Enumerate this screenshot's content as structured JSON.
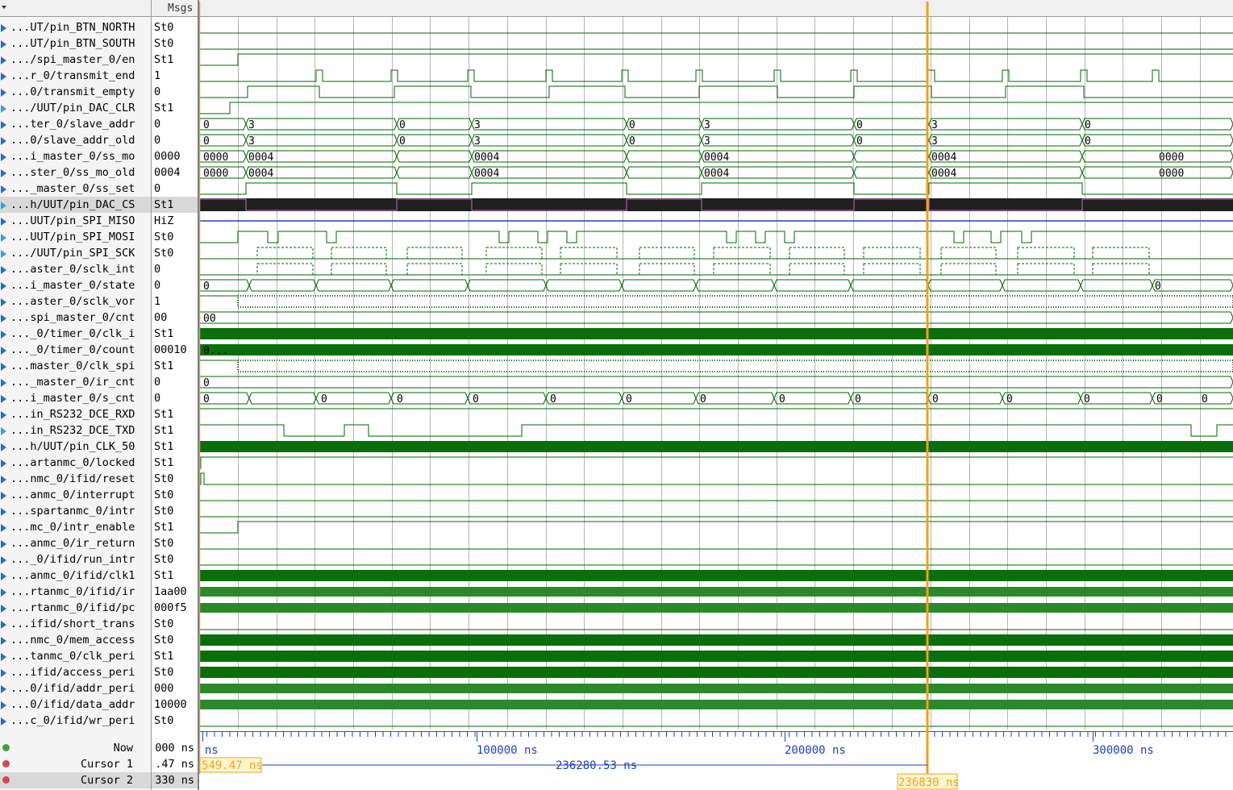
{
  "header": {
    "values_label": "Msgs"
  },
  "signals": [
    {
      "name": "...UT/pin_BTN_NORTH",
      "value": "St0",
      "kind": "bit",
      "icon": "in-icon"
    },
    {
      "name": "...UT/pin_BTN_SOUTH",
      "value": "St0",
      "kind": "bit",
      "icon": "in-icon"
    },
    {
      "name": ".../spi_master_0/en",
      "value": "St1",
      "kind": "bit",
      "icon": "in-icon"
    },
    {
      "name": "...r_0/transmit_end",
      "value": "1",
      "kind": "bit",
      "icon": "in-icon"
    },
    {
      "name": "...0/transmit_empty",
      "value": "0",
      "kind": "bit",
      "icon": "in-icon"
    },
    {
      "name": ".../UUT/pin_DAC_CLR",
      "value": "St1",
      "kind": "bit",
      "icon": "out-icon"
    },
    {
      "name": "...ter_0/slave_addr",
      "value": "0",
      "kind": "bus",
      "icon": "in-icon"
    },
    {
      "name": "...0/slave_addr_old",
      "value": "0",
      "kind": "bus",
      "icon": "in-icon"
    },
    {
      "name": "...i_master_0/ss_mo",
      "value": "0000",
      "kind": "bus",
      "icon": "in-icon"
    },
    {
      "name": "...ster_0/ss_mo_old",
      "value": "0004",
      "kind": "bus",
      "icon": "in-icon"
    },
    {
      "name": "..._master_0/ss_set",
      "value": "0",
      "kind": "bit",
      "icon": "in-icon"
    },
    {
      "name": "...h/UUT/pin_DAC_CS",
      "value": "St1",
      "kind": "selected",
      "icon": "out-icon"
    },
    {
      "name": "...UUT/pin_SPI_MISO",
      "value": "HiZ",
      "kind": "hiz",
      "icon": "in-icon"
    },
    {
      "name": "...UUT/pin_SPI_MOSI",
      "value": "St0",
      "kind": "bit",
      "icon": "out-icon"
    },
    {
      "name": ".../UUT/pin_SPI_SCK",
      "value": "St0",
      "kind": "clkburst",
      "icon": "out-icon"
    },
    {
      "name": "...aster_0/sclk_int",
      "value": "0",
      "kind": "clkburst",
      "icon": "in-icon"
    },
    {
      "name": "...i_master_0/state",
      "value": "0",
      "kind": "busdense",
      "icon": "in-icon"
    },
    {
      "name": "...aster_0/sclk_vor",
      "value": "1",
      "kind": "clkfast",
      "icon": "in-icon"
    },
    {
      "name": "...spi_master_0/cnt",
      "value": "00",
      "kind": "bus",
      "icon": "in-icon"
    },
    {
      "name": "..._0/timer_0/clk_i",
      "value": "St1",
      "kind": "solid",
      "icon": "in-icon"
    },
    {
      "name": "..._0/timer_0/count",
      "value": "00010",
      "kind": "solid",
      "icon": "in-icon"
    },
    {
      "name": "...master_0/clk_spi",
      "value": "St1",
      "kind": "clkfast",
      "icon": "in-icon"
    },
    {
      "name": "..._master_0/ir_cnt",
      "value": "0",
      "kind": "bus",
      "icon": "in-icon"
    },
    {
      "name": "...i_master_0/s_cnt",
      "value": "0",
      "kind": "busdense",
      "icon": "in-icon"
    },
    {
      "name": "...in_RS232_DCE_RXD",
      "value": "St1",
      "kind": "bit",
      "icon": "in-icon"
    },
    {
      "name": "...in_RS232_DCE_TXD",
      "value": "St1",
      "kind": "bit",
      "icon": "out-icon"
    },
    {
      "name": "...h/UUT/pin_CLK_50",
      "value": "St1",
      "kind": "solid",
      "icon": "in-icon"
    },
    {
      "name": "...artanmc_0/locked",
      "value": "St1",
      "kind": "bit",
      "icon": "in-icon"
    },
    {
      "name": "...nmc_0/ifid/reset",
      "value": "St0",
      "kind": "bit",
      "icon": "in-icon"
    },
    {
      "name": "...anmc_0/interrupt",
      "value": "St0",
      "kind": "bit",
      "icon": "in-icon"
    },
    {
      "name": "...spartanmc_0/intr",
      "value": "St0",
      "kind": "bit",
      "icon": "in-icon"
    },
    {
      "name": "...mc_0/intr_enable",
      "value": "St1",
      "kind": "bit",
      "icon": "in-icon"
    },
    {
      "name": "...anmc_0/ir_return",
      "value": "St0",
      "kind": "bit",
      "icon": "in-icon"
    },
    {
      "name": "..._0/ifid/run_intr",
      "value": "St0",
      "kind": "bit",
      "icon": "in-icon"
    },
    {
      "name": "...anmc_0/ifid/clk1",
      "value": "St1",
      "kind": "solid",
      "icon": "in-icon"
    },
    {
      "name": "...rtanmc_0/ifid/ir",
      "value": "1aa00",
      "kind": "busband",
      "icon": "in-icon"
    },
    {
      "name": "...rtanmc_0/ifid/pc",
      "value": "000f5",
      "kind": "busband",
      "icon": "in-icon"
    },
    {
      "name": "...ifid/short_trans",
      "value": "St0",
      "kind": "bit",
      "icon": "in-icon"
    },
    {
      "name": "...nmc_0/mem_access",
      "value": "St0",
      "kind": "solid",
      "icon": "in-icon"
    },
    {
      "name": "...tanmc_0/clk_peri",
      "value": "St1",
      "kind": "solid",
      "icon": "in-icon"
    },
    {
      "name": "...ifid/access_peri",
      "value": "St0",
      "kind": "solid",
      "icon": "in-icon"
    },
    {
      "name": "...0/ifid/addr_peri",
      "value": "000",
      "kind": "busband",
      "icon": "in-icon"
    },
    {
      "name": "...0/ifid/data_addr",
      "value": "10000",
      "kind": "busband",
      "icon": "in-icon"
    },
    {
      "name": "...c_0/ifid/wr_peri",
      "value": "St0",
      "kind": "bit",
      "icon": "in-icon"
    }
  ],
  "bus_labels": [
    {
      "row": 6,
      "items": [
        "0",
        "3",
        "0",
        "3",
        "0",
        "3",
        "0",
        "3",
        "0"
      ]
    },
    {
      "row": 7,
      "items": [
        "0",
        "3",
        "0",
        "3",
        "0",
        "3",
        "0",
        "3",
        "0"
      ]
    },
    {
      "row": 8,
      "items": [
        "0000",
        "0004",
        "0004",
        "0004",
        "0004",
        "0000"
      ]
    },
    {
      "row": 9,
      "items": [
        "0000",
        "0004",
        "0004",
        "0004",
        "0004",
        "0000"
      ]
    },
    {
      "row": 16,
      "items": [
        "0",
        "0"
      ]
    },
    {
      "row": 18,
      "items": [
        "00"
      ]
    },
    {
      "row": 20,
      "items": [
        "0..."
      ]
    },
    {
      "row": 22,
      "items": [
        "0"
      ]
    },
    {
      "row": 23,
      "items": [
        "0",
        "0",
        "0",
        "0",
        "0",
        "0",
        "0",
        "0",
        "0",
        "0",
        "0",
        "0",
        "0",
        "0"
      ]
    }
  ],
  "timeline": {
    "ticks": [
      "0 ns",
      "100000 ns",
      "200000 ns",
      "300000 ns"
    ],
    "cursor_delta": "236280.53 ns",
    "cursor1_flag": "549.47 ns",
    "cursor2_flag": "236830 ns"
  },
  "footer": [
    {
      "label": "Now",
      "value": "000 ns"
    },
    {
      "label": "Cursor 1",
      "value": ".47 ns"
    },
    {
      "label": "Cursor 2",
      "value": "330 ns"
    }
  ],
  "colors": {
    "wave": "#006400",
    "wave_solid": "#0a6e0a",
    "grid": "#b4b4b4",
    "cursor_active": "#f0a020",
    "selected_wave": "#202020",
    "hiz": "#2040c0"
  }
}
